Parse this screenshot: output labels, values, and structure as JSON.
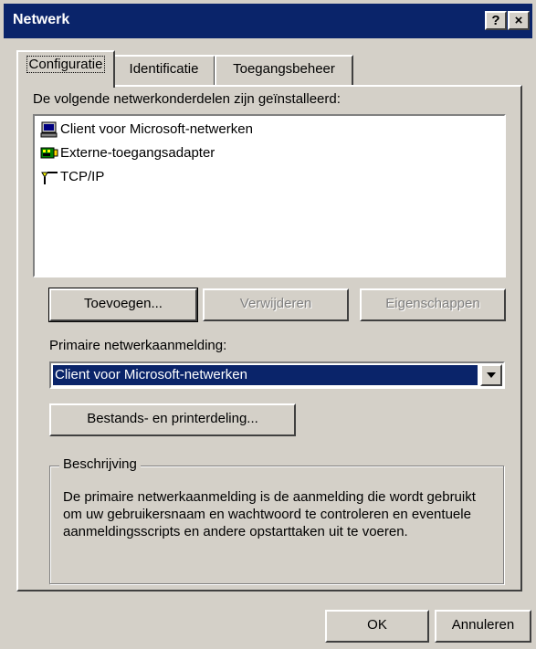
{
  "window": {
    "title": "Netwerk"
  },
  "titlebar": {
    "help_label": "?",
    "close_label": "×"
  },
  "tabs": [
    {
      "label": "Configuratie",
      "active": true
    },
    {
      "label": "Identificatie",
      "active": false
    },
    {
      "label": "Toegangsbeheer",
      "active": false
    }
  ],
  "components": {
    "heading": "De volgende netwerkonderdelen zijn geïnstalleerd:",
    "items": [
      {
        "label": "Client voor Microsoft-netwerken",
        "icon": "network-client-icon"
      },
      {
        "label": "Externe-toegangsadapter",
        "icon": "network-adapter-icon"
      },
      {
        "label": "TCP/IP",
        "icon": "protocol-icon"
      }
    ]
  },
  "buttons": {
    "add": "Toevoegen...",
    "remove": "Verwijderen",
    "properties": "Eigenschappen",
    "file_print": "Bestands- en printerdeling...",
    "ok": "OK",
    "cancel": "Annuleren"
  },
  "logon": {
    "label": "Primaire netwerkaanmelding:",
    "selected": "Client voor Microsoft-netwerken"
  },
  "description": {
    "title": "Beschrijving",
    "text": "De primaire netwerkaanmelding is de aanmelding die wordt gebruikt om uw gebruikersnaam en wachtwoord te controleren en eventuele aanmeldingsscripts en andere opstarttaken uit te voeren."
  },
  "colors": {
    "titlebar": "#0a246a",
    "face": "#d4d0c8",
    "selection": "#0a246a"
  }
}
